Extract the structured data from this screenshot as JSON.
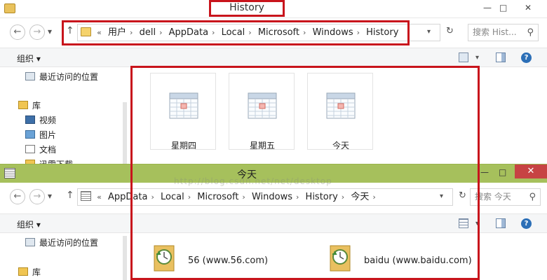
{
  "window1": {
    "title": "History",
    "controls": {
      "minimize": "—",
      "maximize": "□",
      "close": "✕"
    },
    "address": {
      "prefix": "«",
      "crumbs": [
        "用户",
        "dell",
        "AppData",
        "Local",
        "Microsoft",
        "Windows",
        "History"
      ]
    },
    "search_placeholder": "搜索 Hist...",
    "toolbar": {
      "organize": "组织 ▾"
    },
    "sidebar": [
      {
        "label": "最近访问的位置",
        "icon": "recent-places-icon"
      },
      {
        "label": "库",
        "icon": "library-icon"
      },
      {
        "label": "视频",
        "icon": "videos-icon"
      },
      {
        "label": "图片",
        "icon": "pictures-icon"
      },
      {
        "label": "文档",
        "icon": "documents-icon"
      },
      {
        "label": "迅雷下载",
        "icon": "download-icon"
      }
    ],
    "folders": [
      {
        "label": "星期四",
        "icon": "calendar-folder-icon"
      },
      {
        "label": "星期五",
        "icon": "calendar-folder-icon"
      },
      {
        "label": "今天",
        "icon": "calendar-folder-icon"
      }
    ]
  },
  "window2": {
    "title": "今天",
    "controls": {
      "minimize": "—",
      "maximize": "□",
      "close": "✕"
    },
    "address": {
      "prefix": "«",
      "crumbs": [
        "AppData",
        "Local",
        "Microsoft",
        "Windows",
        "History",
        "今天"
      ]
    },
    "search_placeholder": "搜索 今天",
    "toolbar": {
      "organize": "组织 ▾"
    },
    "sidebar": [
      {
        "label": "最近访问的位置",
        "icon": "recent-places-icon"
      },
      {
        "label": "库",
        "icon": "library-icon"
      }
    ],
    "files": [
      {
        "label": "56 (www.56.com)",
        "icon": "history-link-icon"
      },
      {
        "label": "baidu (www.baidu.com)",
        "icon": "history-link-icon"
      }
    ]
  },
  "watermark": "http://blog.csdn.net/net/desktop"
}
